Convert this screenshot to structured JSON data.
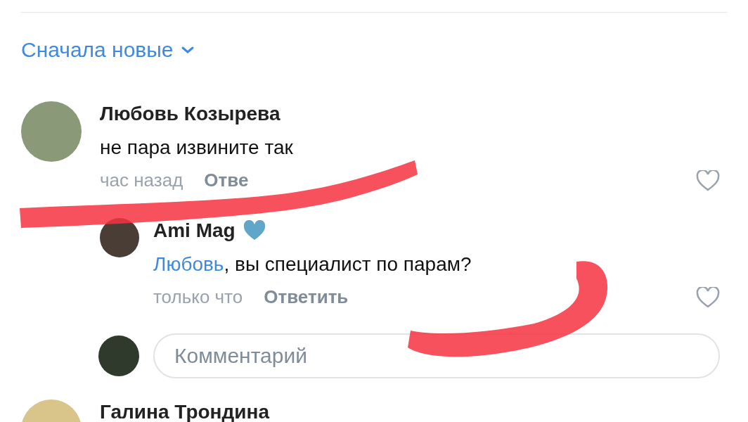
{
  "sort": {
    "label": "Сначала новые"
  },
  "comments": [
    {
      "author": "Любовь Козырева",
      "text": "не пара извините так",
      "time": "час назад",
      "reply_label": "Отве",
      "liked": false,
      "replies": [
        {
          "author": "Ami Mag",
          "mention": "Любовь",
          "text": ", вы специалист по парам?",
          "time": "только что",
          "reply_label": "Ответить",
          "liked": false
        }
      ]
    }
  ],
  "comment_field": {
    "placeholder": "Комментарий"
  },
  "next_comment": {
    "author": "Галина Трондина"
  }
}
